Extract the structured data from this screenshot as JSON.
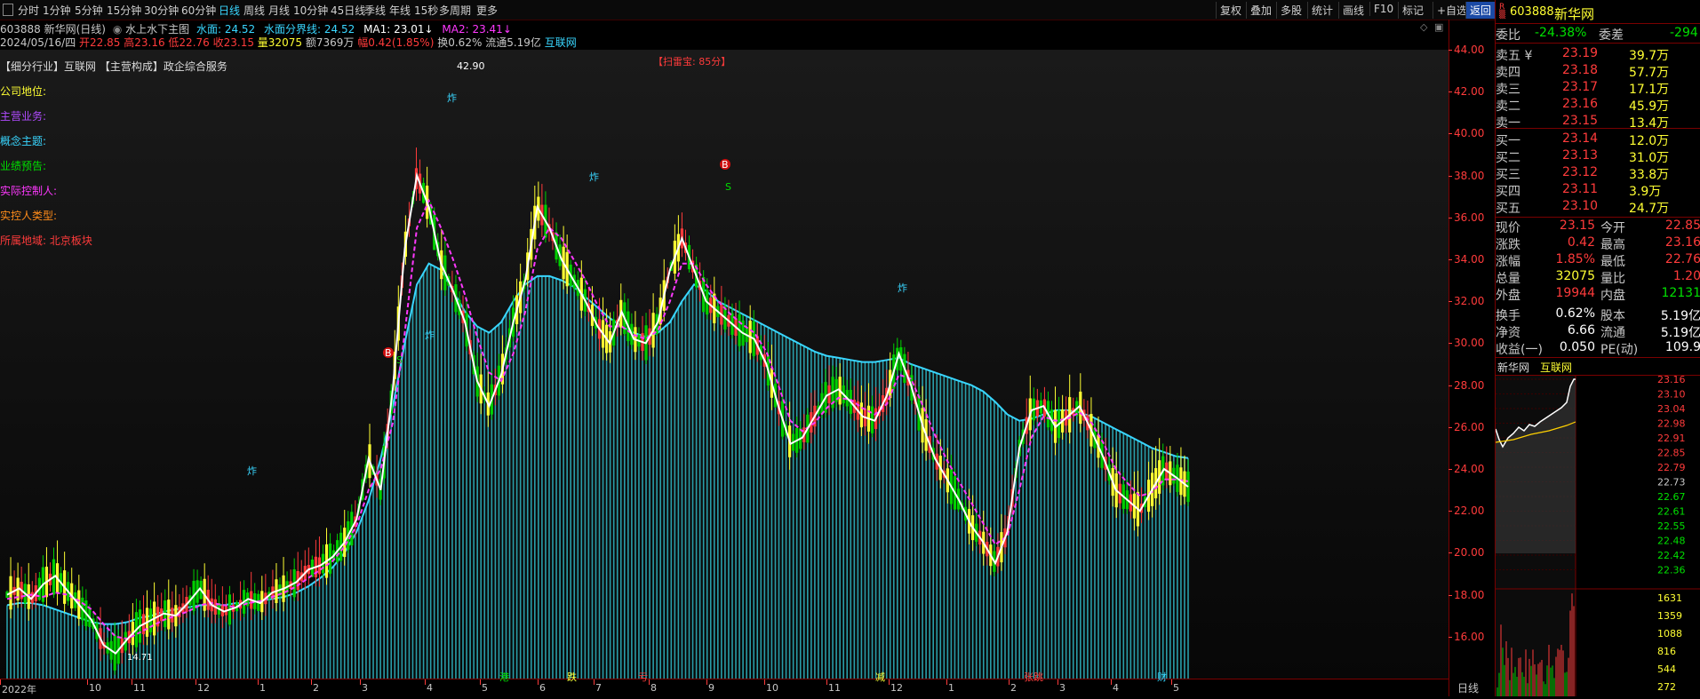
{
  "toolbar": {
    "periods": [
      "分时",
      "1分钟",
      "5分钟",
      "15分钟",
      "30分钟",
      "60分钟",
      "日线",
      "周线",
      "月线",
      "10分钟",
      "45日线",
      "季线",
      "年线",
      "15秒",
      "多周期",
      "更多"
    ],
    "active": "日线",
    "right_buttons": [
      "复权",
      "叠加",
      "多股",
      "统计",
      "画线",
      "F10",
      "标记",
      "+自选",
      "返回"
    ]
  },
  "header": {
    "code_name": "603888 新华网(日线)",
    "indicator": "水上水下主图",
    "water_surface": "水面: 24.52",
    "water_boundary": "水面分界线: 24.52",
    "ma1": "MA1: 23.01",
    "ma2": "MA2: 23.41"
  },
  "ohlc": {
    "date": "2024/05/16/四",
    "open": "开22.85",
    "high": "高23.16",
    "low": "低22.76",
    "close": "收23.15",
    "vol": "量32075",
    "amount": "额7369万",
    "change": "幅0.42(1.85%)",
    "turnover": "换0.62%",
    "float": "流通5.19亿",
    "sector": "互联网"
  },
  "info": {
    "industry_line": "【细分行业】互联网 【主营构成】政企综合服务",
    "company_position": "公司地位:",
    "main_business": "主营业务:",
    "concept": "概念主题:",
    "forecast": "业绩预告:",
    "controller": "实际控制人:",
    "controller_type": "实控人类型:",
    "region": "所属地域: 北京板块"
  },
  "chart_annotations": {
    "scan": "【扫雷宝: 85分】",
    "high_label": "42.90",
    "low_label": "14.71",
    "markers": [
      "炸",
      "B",
      "S",
      "炸",
      "炸",
      "B",
      "S",
      "炸",
      "炸"
    ],
    "bottom_tags": [
      "港",
      "跌",
      "亏",
      "减",
      "张跳",
      "财"
    ]
  },
  "chart_data": {
    "type": "line",
    "y_ticks": [
      "44.00",
      "42.00",
      "40.00",
      "38.00",
      "36.00",
      "34.00",
      "32.00",
      "30.00",
      "28.00",
      "26.00",
      "24.00",
      "22.00",
      "20.00",
      "18.00",
      "16.00"
    ],
    "ylim": [
      14.0,
      44.0
    ],
    "x_ticks": [
      "2022年",
      "10",
      "11",
      "12",
      "1",
      "2",
      "3",
      "4",
      "5",
      "6",
      "7",
      "8",
      "9",
      "10",
      "11",
      "12",
      "1",
      "2",
      "3",
      "4",
      "5"
    ],
    "close_series": [
      18.0,
      18.3,
      17.8,
      18.5,
      18.9,
      18.2,
      17.5,
      16.8,
      15.6,
      15.2,
      15.9,
      16.5,
      16.8,
      17.1,
      17.0,
      17.6,
      18.3,
      17.5,
      17.2,
      17.4,
      17.8,
      17.6,
      18.1,
      18.3,
      18.6,
      19.2,
      19.4,
      19.8,
      20.5,
      21.6,
      24.5,
      23.0,
      27.8,
      34.5,
      38.0,
      36.5,
      33.8,
      32.5,
      31.0,
      28.2,
      27.0,
      28.5,
      31.0,
      33.0,
      36.5,
      35.5,
      34.0,
      33.0,
      32.0,
      30.8,
      30.0,
      31.5,
      30.2,
      30.0,
      31.0,
      33.5,
      35.0,
      33.5,
      32.0,
      31.5,
      31.0,
      30.5,
      30.2,
      29.0,
      27.0,
      25.2,
      25.5,
      26.5,
      27.5,
      27.8,
      27.2,
      26.5,
      26.3,
      27.5,
      29.5,
      28.0,
      26.0,
      24.5,
      23.5,
      22.5,
      21.3,
      20.5,
      19.5,
      21.0,
      25.0,
      26.8,
      27.0,
      26.0,
      26.5,
      27.0,
      25.8,
      24.5,
      23.0,
      22.5,
      22.0,
      23.0,
      24.0,
      23.6,
      23.15
    ],
    "ma_series": [
      17.8,
      17.9,
      18.0,
      17.9,
      18.1,
      18.0,
      17.7,
      17.3,
      16.6,
      16.0,
      15.9,
      16.2,
      16.5,
      16.8,
      17.0,
      17.2,
      17.5,
      17.6,
      17.5,
      17.4,
      17.6,
      17.7,
      17.9,
      18.1,
      18.4,
      18.8,
      19.2,
      19.6,
      20.3,
      21.3,
      23.0,
      24.0,
      26.2,
      30.5,
      35.5,
      36.8,
      35.5,
      34.0,
      32.3,
      30.3,
      28.6,
      28.2,
      29.5,
      31.5,
      34.5,
      35.5,
      35.0,
      34.0,
      33.0,
      31.8,
      30.8,
      30.8,
      30.4,
      30.2,
      30.6,
      32.0,
      33.8,
      33.8,
      32.8,
      32.0,
      31.4,
      30.9,
      30.5,
      29.6,
      28.0,
      26.3,
      25.8,
      26.2,
      26.9,
      27.4,
      27.3,
      26.9,
      26.6,
      27.1,
      28.5,
      28.3,
      27.0,
      25.6,
      24.4,
      23.4,
      22.4,
      21.4,
      20.4,
      20.8,
      23.0,
      25.5,
      26.5,
      26.3,
      26.4,
      26.7,
      26.2,
      25.2,
      24.0,
      23.3,
      22.7,
      22.9,
      23.5,
      23.5,
      23.41
    ],
    "water_series": [
      17.5,
      17.6,
      17.6,
      17.5,
      17.3,
      17.1,
      16.9,
      16.7,
      16.6,
      16.6,
      16.7,
      16.9,
      17.0,
      17.2,
      17.3,
      17.4,
      17.5,
      17.5,
      17.5,
      17.6,
      17.6,
      17.7,
      17.8,
      17.9,
      18.1,
      18.4,
      18.8,
      19.3,
      20.0,
      21.0,
      22.5,
      24.5,
      27.0,
      30.0,
      32.8,
      33.8,
      33.5,
      32.5,
      31.5,
      30.8,
      30.5,
      31.0,
      32.0,
      32.8,
      33.2,
      33.2,
      33.0,
      32.7,
      32.2,
      31.7,
      31.2,
      30.8,
      30.5,
      30.3,
      30.5,
      31.0,
      32.0,
      32.8,
      32.5,
      32.0,
      31.7,
      31.4,
      31.1,
      30.8,
      30.5,
      30.2,
      29.9,
      29.6,
      29.4,
      29.3,
      29.2,
      29.1,
      29.1,
      29.2,
      29.3,
      29.0,
      28.8,
      28.6,
      28.4,
      28.2,
      28.0,
      27.7,
      27.2,
      26.6,
      26.3,
      26.4,
      26.6,
      26.8,
      26.8,
      26.7,
      26.5,
      26.2,
      25.9,
      25.6,
      25.3,
      25.0,
      24.8,
      24.6,
      24.52
    ],
    "colors": {
      "water": "#39d6ff",
      "close": "#ffffff",
      "ma": "#ff38ff"
    }
  },
  "quote": {
    "code": "603888",
    "name": "新华网",
    "weibi_label": "委比",
    "weibi": "-24.38%",
    "weicha_label": "委差",
    "weicha": "-294",
    "asks": [
      {
        "label": "卖五 ¥",
        "price": "23.19",
        "vol": "39.7万"
      },
      {
        "label": "卖四",
        "price": "23.18",
        "vol": "57.7万"
      },
      {
        "label": "卖三",
        "price": "23.17",
        "vol": "17.1万"
      },
      {
        "label": "卖二",
        "price": "23.16",
        "vol": "45.9万"
      },
      {
        "label": "卖一",
        "price": "23.15",
        "vol": "13.4万"
      }
    ],
    "bids": [
      {
        "label": "买一",
        "price": "23.14",
        "vol": "12.0万"
      },
      {
        "label": "买二",
        "price": "23.13",
        "vol": "31.0万"
      },
      {
        "label": "买三",
        "price": "23.12",
        "vol": "33.8万"
      },
      {
        "label": "买四",
        "price": "23.11",
        "vol": "3.9万"
      },
      {
        "label": "买五",
        "price": "23.10",
        "vol": "24.7万"
      }
    ],
    "stats": [
      {
        "l1": "现价",
        "v1": "23.15",
        "c1": "red",
        "l2": "今开",
        "v2": "22.85",
        "c2": "red"
      },
      {
        "l1": "涨跌",
        "v1": "0.42",
        "c1": "red",
        "l2": "最高",
        "v2": "23.16",
        "c2": "red"
      },
      {
        "l1": "涨幅",
        "v1": "1.85%",
        "c1": "red",
        "l2": "最低",
        "v2": "22.76",
        "c2": "red"
      },
      {
        "l1": "总量",
        "v1": "32075",
        "c1": "yel",
        "l2": "量比",
        "v2": "1.20",
        "c2": "red"
      },
      {
        "l1": "外盘",
        "v1": "19944",
        "c1": "red",
        "l2": "内盘",
        "v2": "12131",
        "c2": "grn"
      },
      {
        "l1": "换手",
        "v1": "0.62%",
        "c1": "wht",
        "l2": "股本",
        "v2": "5.19亿",
        "c2": "wht"
      },
      {
        "l1": "净资",
        "v1": "6.66",
        "c1": "wht",
        "l2": "流通",
        "v2": "5.19亿",
        "c2": "wht"
      },
      {
        "l1": "收益(一)",
        "v1": "0.050",
        "c1": "wht",
        "l2": "PE(动)",
        "v2": "109.9",
        "c2": "wht"
      }
    ],
    "mini_tabs": [
      "新华网",
      "互联网"
    ],
    "mini_prices": [
      "23.16",
      "23.10",
      "23.04",
      "22.98",
      "22.91",
      "22.85",
      "22.79",
      "22.73",
      "22.67",
      "22.61",
      "22.55",
      "22.48",
      "22.42",
      "22.36"
    ],
    "mini_vols": [
      "1631",
      "1359",
      "1088",
      "816",
      "544",
      "272"
    ],
    "footer_tab": "日线"
  }
}
